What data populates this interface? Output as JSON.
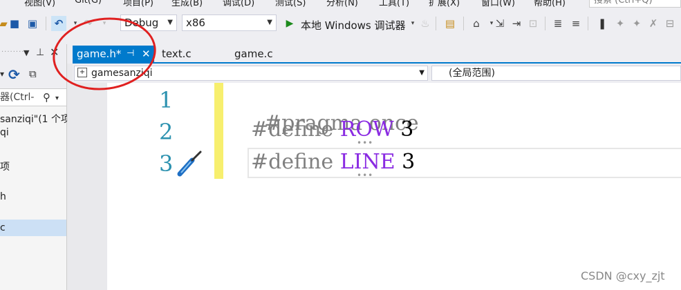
{
  "menu": {
    "items": [
      "视图(V)",
      "Git(G)",
      "项目(P)",
      "生成(B)",
      "调试(D)",
      "测试(S)",
      "分析(N)",
      "工具(T)",
      "扩展(X)",
      "窗口(W)",
      "帮助(H)"
    ],
    "search_placeholder": "搜索 (Ctrl+Q)"
  },
  "toolbar": {
    "config": "Debug",
    "platform": "x86",
    "run_label": "本地 Windows 调试器"
  },
  "solution_panel": {
    "search_text": "器(Ctrl-",
    "tree": [
      "sanziqi\"(1 个项",
      "qi",
      "项",
      "h",
      "c"
    ]
  },
  "tabs": [
    {
      "label": "game.h*",
      "pin": "⊣",
      "close": "✕"
    },
    {
      "label": "text.c"
    },
    {
      "label": "game.c"
    }
  ],
  "navbar": {
    "project": "gamesanziqi",
    "scope": "(全局范围)"
  },
  "editor": {
    "lines": [
      {
        "num": "1",
        "kw": "#pragma once",
        "mac": "",
        "val": ""
      },
      {
        "num": "2",
        "kw": "#define ",
        "mac": "ROW",
        "val": " 3"
      },
      {
        "num": "3",
        "kw": "#define ",
        "mac": "LINE",
        "val": " 3"
      }
    ]
  },
  "watermark": "CSDN @cxy_zjt",
  "colors": {
    "accent": "#007acc",
    "annotation": "#e02020",
    "macro": "#8a2be2",
    "line_number": "#2b91af"
  }
}
